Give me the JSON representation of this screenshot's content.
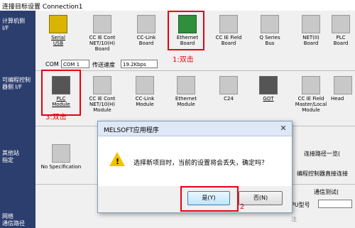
{
  "window": {
    "title": "连接目标设置 Connection1"
  },
  "sidebar": {
    "pc_if": "计算机侧\nI/F",
    "plc_if": "可编程控制\n器侧 I/F",
    "other_station": "其他站\n指定",
    "network_route": "网络\n通信路径"
  },
  "pc_row": {
    "items": [
      {
        "label": "Serial\nUSB",
        "icon": "serial-usb-icon"
      },
      {
        "label": "CC IE Cont\nNET/10(H)\nBoard",
        "icon": "board-icon"
      },
      {
        "label": "CC-Link\nBoard",
        "icon": "board-icon"
      },
      {
        "label": "Ethernet\nBoard",
        "icon": "ethernet-board-icon"
      },
      {
        "label": "CC IE Field\nBoard",
        "icon": "board-icon"
      },
      {
        "label": "Q Series\nBus",
        "icon": "bus-icon"
      },
      {
        "label": "NET(II)\nBoard",
        "icon": "board-icon"
      },
      {
        "label": "PLC\nBoard",
        "icon": "board-icon"
      }
    ],
    "com_label": "COM",
    "com_value": "COM 1",
    "speed_label": "传送速度",
    "speed_value": "19.2Kbps"
  },
  "plc_row": {
    "items": [
      {
        "label": "PLC\nModule",
        "icon": "plc-module-icon"
      },
      {
        "label": "CC IE Cont\nNET/10(H)\nModule",
        "icon": "module-icon"
      },
      {
        "label": "CC-Link\nModule",
        "icon": "module-icon"
      },
      {
        "label": "Ethernet\nModule",
        "icon": "module-icon"
      },
      {
        "label": "C24",
        "icon": "module-icon"
      },
      {
        "label": "GOT",
        "icon": "got-icon"
      },
      {
        "label": "CC IE Field\nMaster/Local\nModule",
        "icon": "module-icon"
      },
      {
        "label": "Head",
        "icon": "module-icon"
      }
    ]
  },
  "other": {
    "no_spec": "No Specification",
    "route_list": "连接路径一览(",
    "direct_connect": "编程控制器直接连接",
    "comm_test": "通信测试(",
    "cpu_model": "PU型号",
    "cpu_value": "",
    "note": "注"
  },
  "annotations": {
    "step1": "1:双击",
    "step2": "2",
    "step3": "3:双击"
  },
  "dialog": {
    "title": "MELSOFT应用程序",
    "message": "选择新项目时，当前的设置将会丢失，确定吗？",
    "yes": "是(Y)",
    "no": "否(N)",
    "close": "✕"
  }
}
